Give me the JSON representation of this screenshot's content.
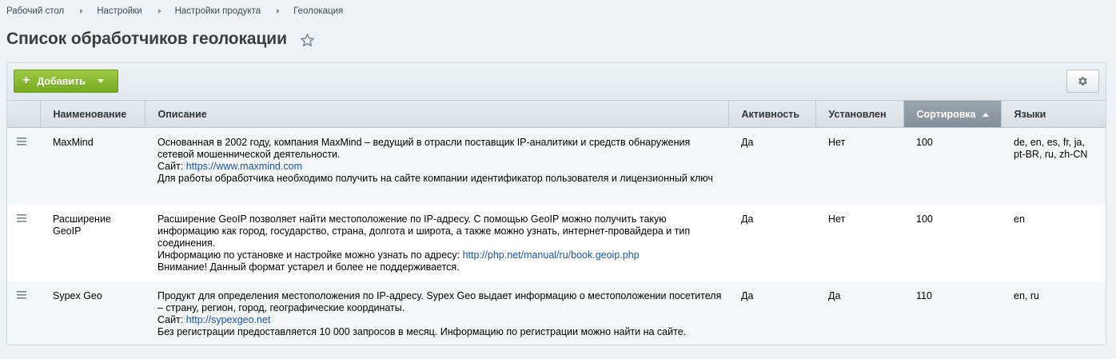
{
  "breadcrumb": [
    "Рабочий стол",
    "Настройки",
    "Настройки продукта",
    "Геолокация"
  ],
  "page_title": "Список обработчиков геолокации",
  "toolbar": {
    "add_label": "Добавить"
  },
  "table": {
    "columns": {
      "name": "Наименование",
      "description": "Описание",
      "active": "Активность",
      "installed": "Установлен",
      "sort": "Сортировка",
      "languages": "Языки"
    },
    "rows": [
      {
        "name": "MaxMind",
        "desc1": "Основанная в 2002 году, компания MaxMind – ведущий в отрасли поставщик IP-аналитики и средств обнаружения сетевой мошеннической деятельности.",
        "site_label": "Сайт:",
        "site_url": "https://www.maxmind.com",
        "desc2": "Для работы обработчика необходимо получить на сайте компании идентификатор пользователя и лицензионный ключ",
        "active": "Да",
        "installed": "Нет",
        "sort": "100",
        "languages": "de, en, es, fr, ja, pt-BR, ru, zh-CN"
      },
      {
        "name": "Расширение GeoIP",
        "desc1": "Расширение GeoIP позволяет найти местоположение по IP-адресу. С помощью GeoIP можно получить такую информацию как город, государство, страна, долгота и широта, а также можно узнать, интернет-провайдера и тип соединения.",
        "info_label": "Информацию по установке и настройке можно узнать по адресу:",
        "info_url": "http://php.net/manual/ru/book.geoip.php",
        "desc2": "Внимание! Данный формат устарел и более не поддерживается.",
        "active": "Да",
        "installed": "Нет",
        "sort": "100",
        "languages": "en"
      },
      {
        "name": "Sypex Geo",
        "desc1": "Продукт для определения местоположения по IP-адресу. Sypex Geo выдает информацию о местоположении посетителя – страну, регион, город, географические координаты.",
        "site_label": "Сайт:",
        "site_url": "http://sypexgeo.net",
        "desc2": "Без регистрации предоставляется 10 000 запросов в месяц. Информацию по регистрации можно найти на сайте.",
        "active": "Да",
        "installed": "Да",
        "sort": "110",
        "languages": "en, ru"
      }
    ]
  },
  "colors": {
    "link": "#1a53a8",
    "add_button": "#82b52a",
    "sorted_header": "#8c98a0",
    "page_background": "#eef2f4"
  }
}
